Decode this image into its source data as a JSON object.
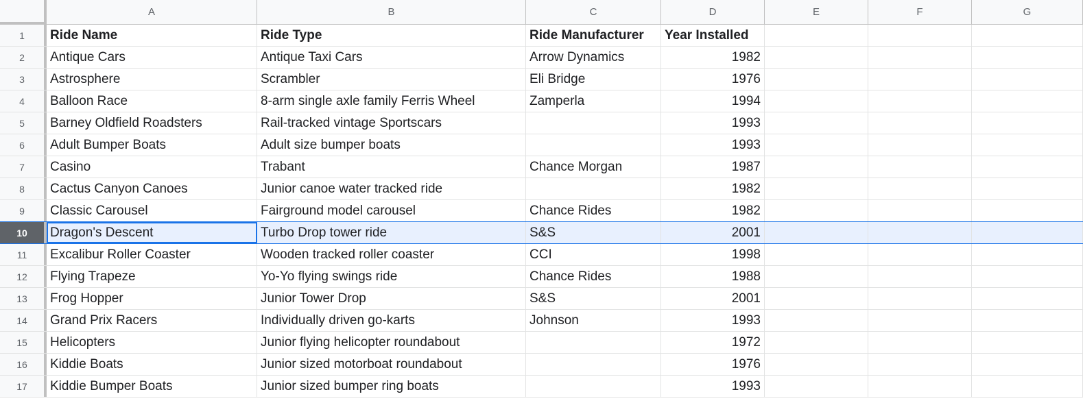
{
  "columns": [
    "A",
    "B",
    "C",
    "D",
    "E",
    "F",
    "G"
  ],
  "header": {
    "row_number": "1",
    "ride_name": "Ride Name",
    "ride_type": "Ride Type",
    "manufacturer": "Ride Manufacturer",
    "year": "Year Installed"
  },
  "rows": [
    {
      "n": "2",
      "name": "Antique Cars",
      "type": "Antique Taxi Cars",
      "mfr": "Arrow Dynamics",
      "year": "1982"
    },
    {
      "n": "3",
      "name": "Astrosphere",
      "type": "Scrambler",
      "mfr": "Eli Bridge",
      "year": "1976"
    },
    {
      "n": "4",
      "name": "Balloon Race",
      "type": "8-arm single axle family Ferris Wheel",
      "mfr": "Zamperla",
      "year": "1994"
    },
    {
      "n": "5",
      "name": "Barney Oldfield Roadsters",
      "type": "Rail-tracked vintage Sportscars",
      "mfr": "",
      "year": "1993"
    },
    {
      "n": "6",
      "name": "Adult Bumper Boats",
      "type": "Adult size bumper boats",
      "mfr": "",
      "year": "1993"
    },
    {
      "n": "7",
      "name": "Casino",
      "type": "Trabant",
      "mfr": "Chance Morgan",
      "year": "1987"
    },
    {
      "n": "8",
      "name": "Cactus Canyon Canoes",
      "type": "Junior canoe water tracked ride",
      "mfr": "",
      "year": "1982"
    },
    {
      "n": "9",
      "name": "Classic Carousel",
      "type": "Fairground model carousel",
      "mfr": "Chance Rides",
      "year": "1982"
    },
    {
      "n": "10",
      "name": "Dragon's Descent",
      "type": "Turbo Drop tower ride",
      "mfr": "S&S",
      "year": "2001"
    },
    {
      "n": "11",
      "name": "Excalibur Roller Coaster",
      "type": "Wooden tracked roller coaster",
      "mfr": "CCI",
      "year": "1998"
    },
    {
      "n": "12",
      "name": "Flying Trapeze",
      "type": "Yo-Yo flying swings ride",
      "mfr": "Chance Rides",
      "year": "1988"
    },
    {
      "n": "13",
      "name": "Frog Hopper",
      "type": "Junior Tower Drop",
      "mfr": "S&S",
      "year": "2001"
    },
    {
      "n": "14",
      "name": "Grand Prix Racers",
      "type": "Individually driven go-karts",
      "mfr": "Johnson",
      "year": "1993"
    },
    {
      "n": "15",
      "name": "Helicopters",
      "type": "Junior flying helicopter roundabout",
      "mfr": "",
      "year": "1972"
    },
    {
      "n": "16",
      "name": "Kiddie Boats",
      "type": "Junior sized motorboat roundabout",
      "mfr": "",
      "year": "1976"
    },
    {
      "n": "17",
      "name": "Kiddie Bumper Boats",
      "type": "Junior sized bumper ring boats",
      "mfr": "",
      "year": "1993"
    }
  ],
  "selection": {
    "row": "10",
    "column": "A"
  },
  "colors": {
    "accent": "#1a73e8",
    "selected_row_fill": "#e8f0fe",
    "header_bg": "#f8f9fa"
  }
}
